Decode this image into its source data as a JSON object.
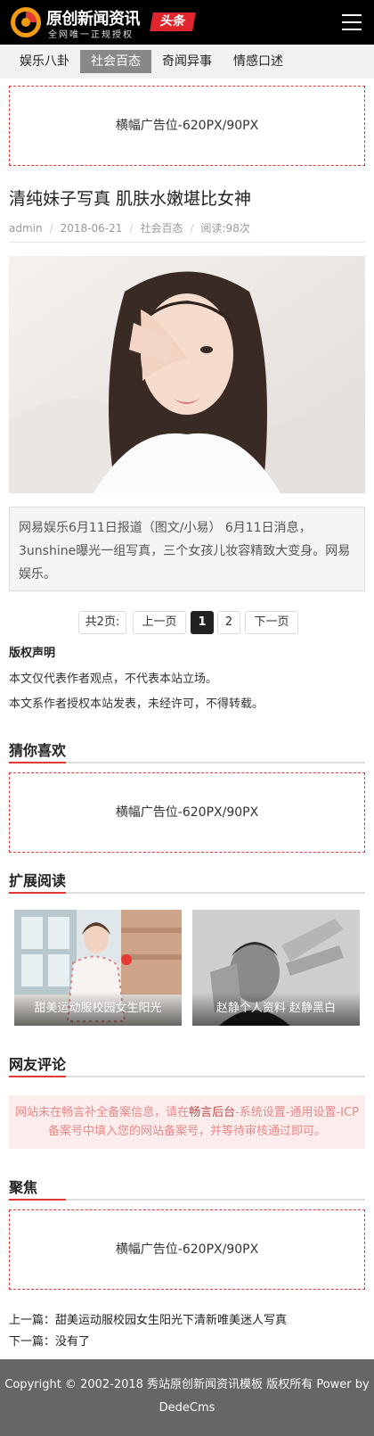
{
  "header": {
    "logo_title": "原创新闻资讯",
    "logo_subtitle": "全网唯一正规授权",
    "badge": "头条",
    "menu_icon": "hamburger-menu-icon"
  },
  "nav": {
    "items": [
      {
        "label": "娱乐八卦",
        "active": false
      },
      {
        "label": "社会百态",
        "active": true
      },
      {
        "label": "奇闻异事",
        "active": false
      },
      {
        "label": "情感口述",
        "active": false
      }
    ]
  },
  "ads": {
    "top": "横幅广告位-620PX/90PX",
    "guess": "横幅广告位-620PX/90PX",
    "focus": "横幅广告位-620PX/90PX"
  },
  "article": {
    "title": "清纯妹子写真 肌肤水嫩堪比女神",
    "author": "admin",
    "date": "2018-06-21",
    "category": "社会百态",
    "views": "阅读:98次",
    "summary": "网易娱乐6月11日报道（图文/小易） 6月11日消息，3unshine曝光一组写真，三个女孩儿妆容精致大变身。网易娱乐。"
  },
  "pagination": {
    "total": "共2页:",
    "prev": "上一页",
    "pages": [
      "1",
      "2"
    ],
    "current": "1",
    "next": "下一页"
  },
  "copyright": {
    "heading": "版权声明",
    "line1": "本文仅代表作者观点，不代表本站立场。",
    "line2": "本文系作者授权本站发表，未经许可，不得转载。"
  },
  "sections": {
    "guess": "猜你喜欢",
    "extended": "扩展阅读",
    "comments": "网友评论",
    "focus": "聚焦"
  },
  "extended_reading": [
    {
      "caption": "甜美运动服校园女生阳光"
    },
    {
      "caption": "赵静个人资料 赵静黑白"
    }
  ],
  "comments_notice": {
    "part1": "网站未在畅言补全备案信息，请在",
    "link": "畅言后台",
    "part2": "-系统设置-通用设置-ICP备案号中填入您的网站备案号，并等待审核通过即可。"
  },
  "prev_next": {
    "prev_label": "上一篇：",
    "prev_title": "甜美运动服校园女生阳光下清新唯美迷人写真",
    "next_label": "下一篇：",
    "next_title": "没有了"
  },
  "footer": {
    "text": "Copyright © 2002-2018 秀站原创新闻资讯模板 版权所有 Power by DedeCms"
  },
  "colors": {
    "accent": "#e53935",
    "header_bg": "#000000",
    "footer_bg": "#666666"
  }
}
